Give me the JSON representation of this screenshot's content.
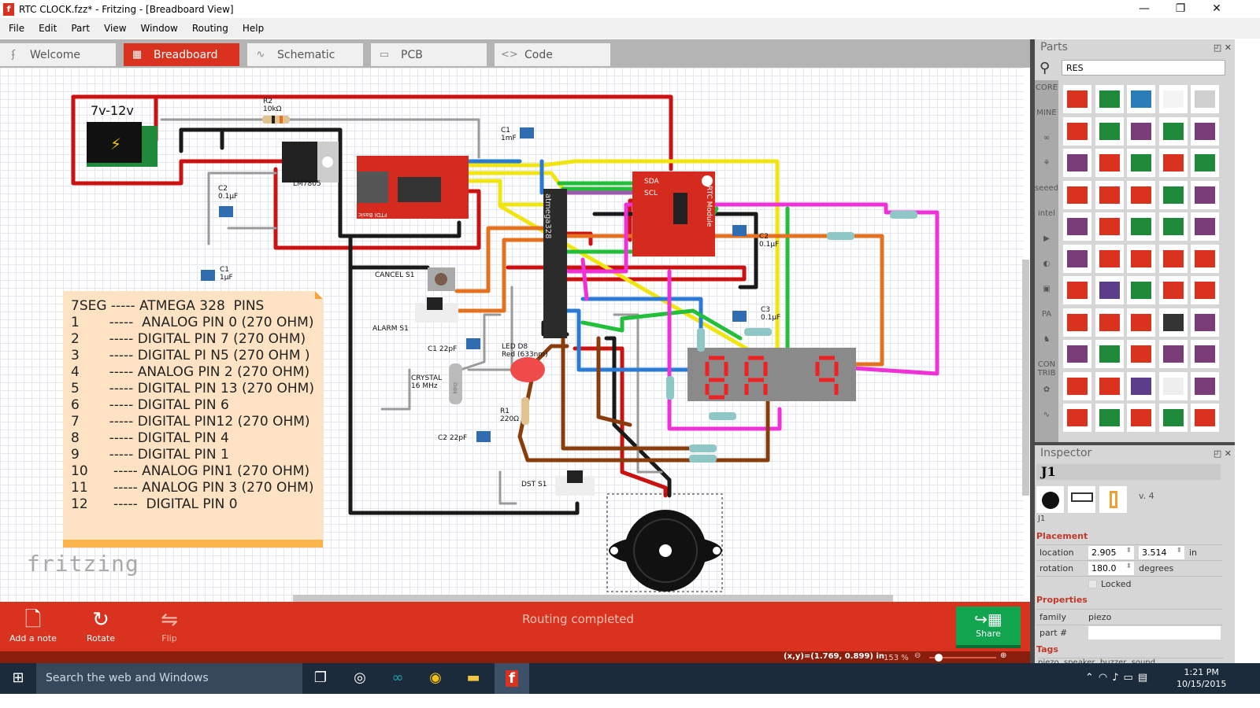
{
  "window": {
    "title": "RTC CLOCK.fzz* - Fritzing - [Breadboard View]",
    "minimize": "—",
    "restore": "❐",
    "close": "✕"
  },
  "menu": [
    "File",
    "Edit",
    "Part",
    "View",
    "Window",
    "Routing",
    "Help"
  ],
  "tabs": [
    {
      "label": "Welcome",
      "icon": "welcome-icon"
    },
    {
      "label": "Breadboard",
      "icon": "breadboard-icon",
      "active": true
    },
    {
      "label": "Schematic",
      "icon": "schematic-icon"
    },
    {
      "label": "PCB",
      "icon": "pcb-icon"
    },
    {
      "label": "Code",
      "icon": "code-icon"
    }
  ],
  "canvas": {
    "labels": {
      "power": "7v-12v",
      "r2": "R2\n10kΩ",
      "reg": "LM7805",
      "c2a": "C2\n0.1µF",
      "c1a": "C1\n1µF",
      "c1b": "C1\n1mF",
      "cancel": "CANCEL S1",
      "alarm": "ALARM S1",
      "c1c": "C1 22pF",
      "crystal": "CRYSTAL\n16 MHz",
      "c2c": "C2 22pF",
      "led": "LED D8\nRed (633nm)",
      "r1": "R1\n220Ω",
      "dst": "DST S1",
      "c2b": "C2\n0.1µF",
      "c3": "C3\n0.1µF",
      "mcu": "atmega328",
      "sda": "SDA",
      "scl": "SCL",
      "rtc": "RTC Module",
      "ftdi": "FTDI Basic",
      "mhz": "MHz"
    },
    "note": {
      "lines": [
        "7SEG ----- ATMEGA 328  PINS",
        "1       -----  ANALOG PIN 0 (270 OHM)",
        "2       ----- DIGITAL PIN 7 (270 OHM)",
        "3       ----- DIGITAL PI N5 (270 OHM )",
        "4       ----- ANALOG PIN 2 (270 OHM)",
        "5       ----- DIGITAL PIN 13 (270 OHM)",
        "6       ----- DIGITAL PIN 6",
        "7       ----- DIGITAL PIN12 (270 OHM)",
        "8       ----- DIGITAL PIN 4",
        "9       ----- DIGITAL PIN 1",
        "10      ----- ANALOG PIN1 (270 OHM)",
        "11      ----- ANALOG PIN 3 (270 OHM)",
        "12      -----  DIGITAL PIN 0"
      ]
    },
    "logo": "fritzing"
  },
  "toolbar": {
    "add_note": "Add a note",
    "rotate": "Rotate",
    "flip": "Flip",
    "status": "Routing completed",
    "share": "Share"
  },
  "statusbar": {
    "coords": "(x,y)=(1.769, 0.899) in",
    "zoom": "153 %",
    "zoom_level": 0.08
  },
  "parts": {
    "title": "Parts",
    "search_value": "RES",
    "bins": [
      "CORE",
      "MINE",
      "∞",
      "⚘",
      "seeed",
      "intel",
      "▶",
      "◐",
      "▣",
      "PA",
      "♞",
      "CON\nTRIB",
      "✿",
      "∿"
    ],
    "thumb_colors": [
      "#d9331f",
      "#1f8a3a",
      "#2a7db8",
      "#f4f4f4",
      "#cfcfcf",
      "#d9331f",
      "#1f8a3a",
      "#7a3d7a",
      "#1f8a3a",
      "#7a3d7a",
      "#7a3d7a",
      "#d9331f",
      "#1f8a3a",
      "#d9331f",
      "#1f8a3a",
      "#d9331f",
      "#d9331f",
      "#d9331f",
      "#1f8a3a",
      "#7a3d7a",
      "#7a3d7a",
      "#d9331f",
      "#1f8a3a",
      "#1f8a3a",
      "#7a3d7a",
      "#7a3d7a",
      "#d9331f",
      "#d9331f",
      "#d9331f",
      "#d9331f",
      "#d9331f",
      "#5b3d8a",
      "#1f8a3a",
      "#d9331f",
      "#d9331f",
      "#d9331f",
      "#d9331f",
      "#d9331f",
      "#333333",
      "#7a3d7a",
      "#7a3d7a",
      "#1f8a3a",
      "#d9331f",
      "#7a3d7a",
      "#7a3d7a",
      "#d9331f",
      "#d9331f",
      "#5b3d8a",
      "#eeeeee",
      "#7a3d7a",
      "#d9331f",
      "#1f8a3a",
      "#d9331f",
      "#1f8a3a",
      "#d9331f"
    ]
  },
  "inspector": {
    "title": "Inspector",
    "part_title": "J1",
    "version": "v. 4",
    "part_label": "J1",
    "placement": "Placement",
    "location_label": "location",
    "loc_x": "2.905",
    "loc_y": "3.514",
    "loc_unit": "in",
    "rotation_label": "rotation",
    "rotation": "180.0",
    "rotation_unit": "degrees",
    "locked": "Locked",
    "properties": "Properties",
    "family_label": "family",
    "family": "piezo",
    "partno_label": "part #",
    "partno": "",
    "tags": "Tags",
    "tags_value": "piezo, speaker, buzzer, sound"
  },
  "taskbar": {
    "search_placeholder": "Search the web and Windows",
    "time": "1:21 PM",
    "date": "10/15/2015"
  }
}
